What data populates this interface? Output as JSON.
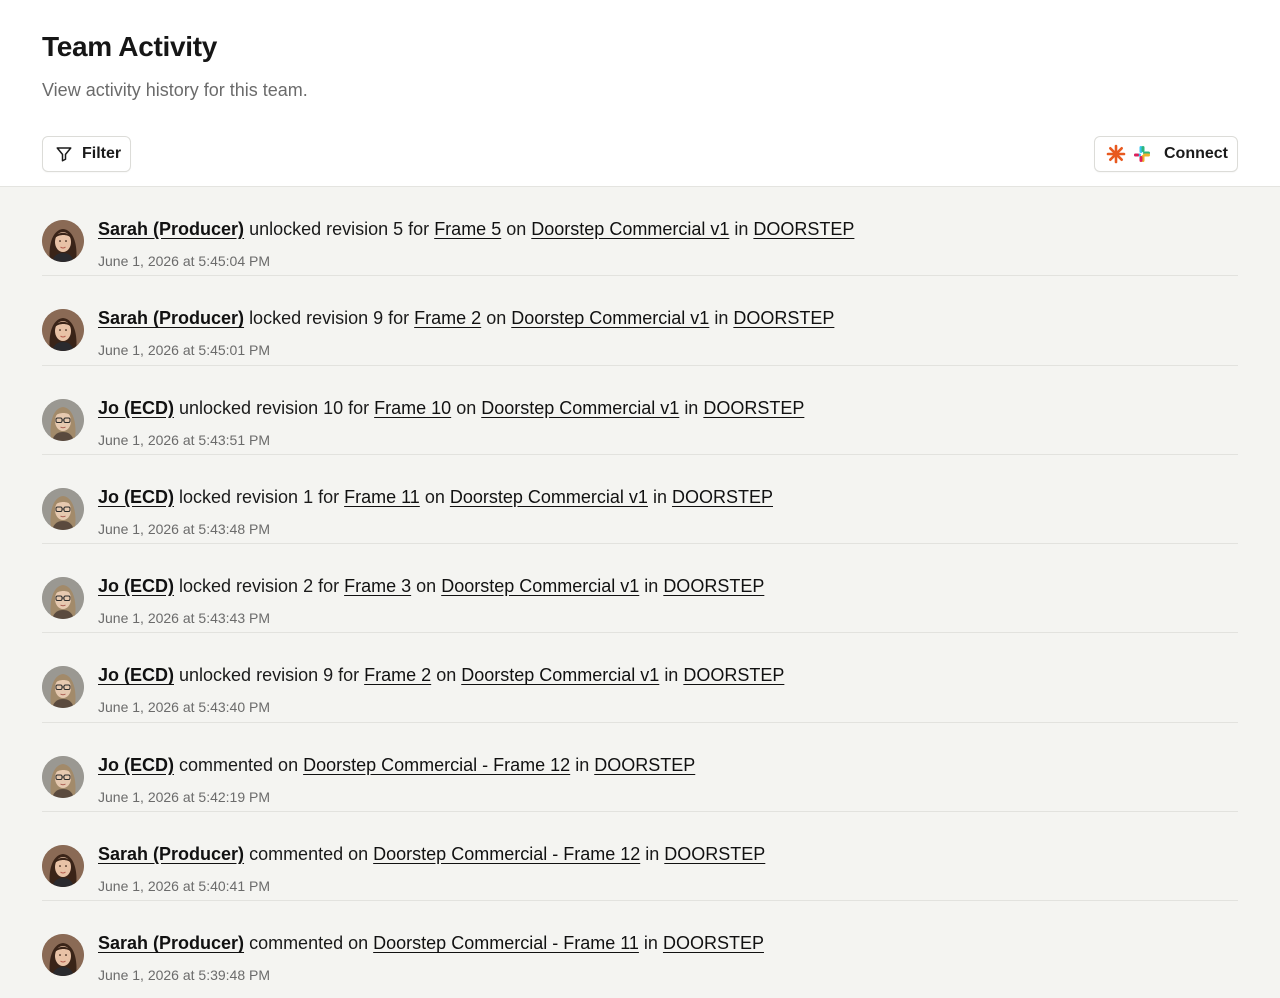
{
  "header": {
    "title": "Team Activity",
    "subtitle": "View activity history for this team."
  },
  "toolbar": {
    "filter_label": "Filter",
    "filter_icon": "funnel-icon",
    "connect_label": "Connect",
    "connect_icons": [
      "claude-logo-icon",
      "slack-logo-icon"
    ],
    "claude_color": "#e8591f"
  },
  "activity": [
    {
      "actor": "Sarah (Producer)",
      "avatar": "sarah",
      "action": "unlocked revision 5 for",
      "target": "Frame 5",
      "project": "Doorstep Commercial v1",
      "team": "DOORSTEP",
      "timestamp": "June 1, 2026 at 5:45:04 PM"
    },
    {
      "actor": "Sarah (Producer)",
      "avatar": "sarah",
      "action": "locked revision 9 for",
      "target": "Frame 2",
      "project": "Doorstep Commercial v1",
      "team": "DOORSTEP",
      "timestamp": "June 1, 2026 at 5:45:01 PM"
    },
    {
      "actor": "Jo (ECD)",
      "avatar": "jo",
      "action": "unlocked revision 10 for",
      "target": "Frame 10",
      "project": "Doorstep Commercial v1",
      "team": "DOORSTEP",
      "timestamp": "June 1, 2026 at 5:43:51 PM"
    },
    {
      "actor": "Jo (ECD)",
      "avatar": "jo",
      "action": "locked revision 1 for",
      "target": "Frame 11",
      "project": "Doorstep Commercial v1",
      "team": "DOORSTEP",
      "timestamp": "June 1, 2026 at 5:43:48 PM"
    },
    {
      "actor": "Jo (ECD)",
      "avatar": "jo",
      "action": "locked revision 2 for",
      "target": "Frame 3",
      "project": "Doorstep Commercial v1",
      "team": "DOORSTEP",
      "timestamp": "June 1, 2026 at 5:43:43 PM"
    },
    {
      "actor": "Jo (ECD)",
      "avatar": "jo",
      "action": "unlocked revision 9 for",
      "target": "Frame 2",
      "project": "Doorstep Commercial v1",
      "team": "DOORSTEP",
      "timestamp": "June 1, 2026 at 5:43:40 PM"
    },
    {
      "actor": "Jo (ECD)",
      "avatar": "jo",
      "action": "commented on",
      "target": "Doorstep Commercial - Frame 12",
      "project": null,
      "team": "DOORSTEP",
      "timestamp": "June 1, 2026 at 5:42:19 PM"
    },
    {
      "actor": "Sarah (Producer)",
      "avatar": "sarah",
      "action": "commented on",
      "target": "Doorstep Commercial - Frame 12",
      "project": null,
      "team": "DOORSTEP",
      "timestamp": "June 1, 2026 at 5:40:41 PM"
    },
    {
      "actor": "Sarah (Producer)",
      "avatar": "sarah",
      "action": "commented on",
      "target": "Doorstep Commercial - Frame 11",
      "project": null,
      "team": "DOORSTEP",
      "timestamp": "June 1, 2026 at 5:39:48 PM"
    }
  ],
  "connectors": {
    "on": "on",
    "in": "in"
  }
}
